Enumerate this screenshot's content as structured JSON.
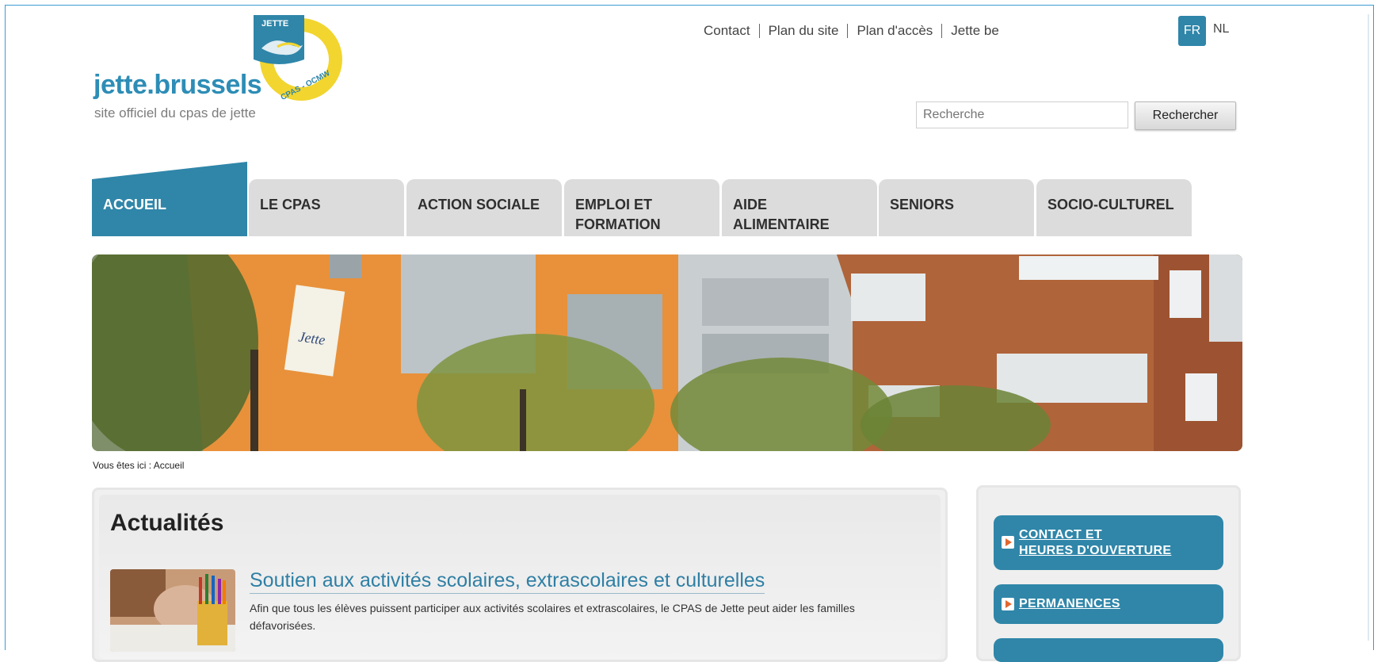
{
  "header": {
    "logo_text": "jette.brussels",
    "logo_subtitle": "site officiel du cpas de jette",
    "emblem_top": "JETTE",
    "emblem_bottom": "CPAS - OCMW",
    "top_links": [
      "Contact",
      "Plan du site",
      "Plan d'accès",
      "Jette be"
    ],
    "languages": {
      "active": "FR",
      "other": "NL"
    },
    "search": {
      "placeholder": "Recherche",
      "button": "Rechercher"
    }
  },
  "nav": {
    "tabs": [
      {
        "label": "ACCUEIL",
        "active": true
      },
      {
        "label": "LE CPAS",
        "active": false
      },
      {
        "label": "ACTION SOCIALE",
        "active": false
      },
      {
        "label": "EMPLOI ET FORMATION",
        "active": false
      },
      {
        "label": "AIDE ALIMENTAIRE",
        "active": false
      },
      {
        "label": "SENIORS",
        "active": false
      },
      {
        "label": "SOCIO-CULTUREL",
        "active": false
      }
    ]
  },
  "hero": {
    "sign_text": "Jette"
  },
  "breadcrumb": "Vous êtes ici : Accueil",
  "news": {
    "section_title": "Actualités",
    "items": [
      {
        "headline": "Soutien aux activités scolaires, extrascolaires et culturelles",
        "text": "Afin que tous les élèves puissent participer aux activités scolaires et extrascolaires, le CPAS de Jette peut aider les familles défavorisées."
      }
    ]
  },
  "sidebar": {
    "buttons": [
      {
        "label_line1": "CONTACT ET",
        "label_line2": "HEURES D'OUVERTURE"
      },
      {
        "label_line1": "PERMANENCES",
        "label_line2": ""
      }
    ]
  },
  "colors": {
    "accent": "#2f86a9",
    "tab_inactive": "#dcdcdc",
    "emblem_yellow": "#f2d52e",
    "arrow_orange": "#e2672f"
  }
}
